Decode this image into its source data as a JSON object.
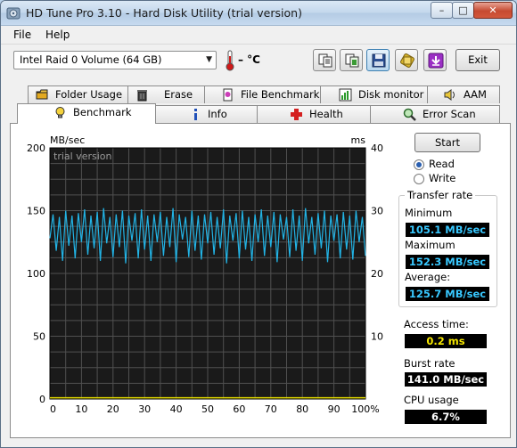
{
  "window": {
    "title": "HD Tune Pro 3.10 - Hard Disk Utility (trial version)",
    "controls": {
      "minimize": "–",
      "maximize": "□",
      "close": "✕"
    }
  },
  "menu": {
    "file": "File",
    "help": "Help"
  },
  "toolbar": {
    "drive": "Intel   Raid 0 Volume (64 GB)",
    "temperature": "– °C",
    "buttons": [
      "copy-text-icon",
      "copy-screenshot-icon",
      "save-icon",
      "options-icon",
      "download-icon"
    ],
    "exit_label": "Exit"
  },
  "tabs_top": [
    {
      "label": "Folder Usage",
      "icon": "folder-icon"
    },
    {
      "label": "Erase",
      "icon": "trash-icon"
    },
    {
      "label": "File Benchmark",
      "icon": "file-benchmark-icon"
    },
    {
      "label": "Disk monitor",
      "icon": "disk-monitor-icon"
    },
    {
      "label": "AAM",
      "icon": "speaker-icon"
    }
  ],
  "tabs_bottom": [
    {
      "label": "Benchmark",
      "icon": "lightbulb-icon",
      "active": true
    },
    {
      "label": "Info",
      "icon": "info-icon"
    },
    {
      "label": "Health",
      "icon": "health-cross-icon"
    },
    {
      "label": "Error Scan",
      "icon": "magnifier-icon"
    }
  ],
  "benchmark": {
    "start_label": "Start",
    "mode_read": "Read",
    "mode_write": "Write",
    "selected_mode": "Read",
    "transfer_rate_title": "Transfer rate",
    "minimum_label": "Minimum",
    "minimum_value": "105.1 MB/sec",
    "maximum_label": "Maximum",
    "maximum_value": "152.3 MB/sec",
    "average_label": "Average:",
    "average_value": "125.7 MB/sec",
    "access_time_label": "Access time:",
    "access_time_value": "0.2 ms",
    "burst_rate_label": "Burst rate",
    "burst_rate_value": "141.0 MB/sec",
    "cpu_usage_label": "CPU usage",
    "cpu_usage_value": "6.7%"
  },
  "chart_data": {
    "type": "line",
    "watermark": "trial version",
    "ylabel_left": "MB/sec",
    "ylabel_right": "ms",
    "ylim_left": [
      0,
      200
    ],
    "ylim_right": [
      0,
      40
    ],
    "yticks_left": [
      0,
      50,
      100,
      150,
      200
    ],
    "yticks_right": [
      10,
      20,
      30,
      40
    ],
    "xlim": [
      0,
      100
    ],
    "xticks": [
      "0",
      "10",
      "20",
      "30",
      "40",
      "50",
      "60",
      "70",
      "80",
      "90",
      "100%"
    ],
    "grid": true,
    "colors": {
      "background": "#1a1a1a",
      "grid": "#505050",
      "transfer": "#22b4e6",
      "access": "#e8e000"
    },
    "series": [
      {
        "name": "Transfer rate",
        "axis": "left",
        "x": [
          0,
          1,
          2,
          3,
          4,
          5,
          6,
          7,
          8,
          9,
          10,
          11,
          12,
          13,
          14,
          15,
          16,
          17,
          18,
          19,
          20,
          21,
          22,
          23,
          24,
          25,
          26,
          27,
          28,
          29,
          30,
          31,
          32,
          33,
          34,
          35,
          36,
          37,
          38,
          39,
          40,
          41,
          42,
          43,
          44,
          45,
          46,
          47,
          48,
          49,
          50,
          51,
          52,
          53,
          54,
          55,
          56,
          57,
          58,
          59,
          60,
          61,
          62,
          63,
          64,
          65,
          66,
          67,
          68,
          69,
          70,
          71,
          72,
          73,
          74,
          75,
          76,
          77,
          78,
          79,
          80,
          81,
          82,
          83,
          84,
          85,
          86,
          87,
          88,
          89,
          90,
          91,
          92,
          93,
          94,
          95,
          96,
          97,
          98,
          99,
          100
        ],
        "values": [
          128,
          147,
          118,
          145,
          110,
          150,
          122,
          146,
          112,
          148,
          125,
          151,
          115,
          146,
          120,
          149,
          110,
          152,
          124,
          145,
          113,
          147,
          121,
          150,
          108,
          146,
          126,
          148,
          112,
          151,
          119,
          146,
          110,
          147,
          125,
          149,
          114,
          145,
          121,
          152,
          109,
          147,
          127,
          145,
          113,
          150,
          118,
          146,
          111,
          147,
          124,
          149,
          115,
          145,
          120,
          151,
          108,
          146,
          126,
          148,
          112,
          150,
          119,
          145,
          110,
          147,
          125,
          151,
          114,
          146,
          121,
          149,
          109,
          147,
          127,
          145,
          113,
          151,
          118,
          146,
          110,
          152,
          124,
          145,
          115,
          148,
          120,
          150,
          109,
          146,
          126,
          147,
          112,
          149,
          119,
          146,
          111,
          150,
          125,
          145,
          114
        ]
      },
      {
        "name": "Access time",
        "axis": "right",
        "x": [
          0,
          100
        ],
        "values": [
          0.2,
          0.2
        ]
      }
    ]
  }
}
